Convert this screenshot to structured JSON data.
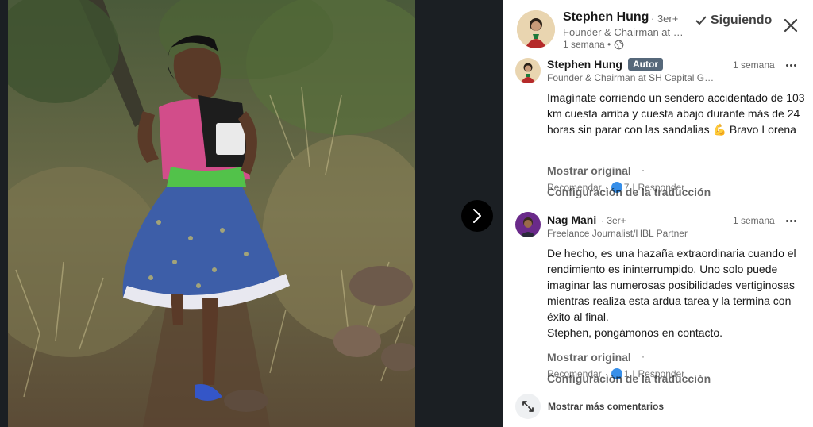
{
  "viewer": {
    "photo_alt": "Runner on trail",
    "next_icon": "chevron-right-icon"
  },
  "post": {
    "author_name": "Stephen Hung",
    "degree": "· 3er+",
    "headline": "Founder & Chairman at SH Capital G…",
    "time": "1 semana •",
    "visibility_icon": "globe-icon",
    "follow_label": "Siguiendo",
    "close_icon": "close-icon"
  },
  "comments": [
    {
      "name": "Stephen Hung",
      "badge": "Autor",
      "degree": "",
      "time": "1 semana",
      "headline": "Founder & Chairman at SH Capital G…",
      "body_lines": [
        "Imagínate corriendo un sendero accidentado de 103 km cuesta arriba y cuesta abajo durante más de 24 horas sin parar con las sandalias 💪 Bravo Lorena"
      ],
      "show_original": "Mostrar original",
      "recommend": "Recomendar",
      "reaction_count": "7",
      "reply": "Responder",
      "config": "Configuración de la traducción"
    },
    {
      "name": "Nag Mani",
      "badge": "",
      "degree": "· 3er+",
      "time": "1 semana",
      "headline": "Freelance Journalist/HBL Partner",
      "body_lines": [
        "De hecho, es una hazaña extraordinaria cuando el rendimiento es ininterrumpido. Uno solo puede imaginar las numerosas posibilidades vertiginosas mientras realiza esta ardua tarea y la termina con éxito al final.",
        "Stephen, pongámonos en contacto."
      ],
      "show_original": "Mostrar original",
      "recommend": "Recomendar",
      "reaction_count": "1",
      "reply": "Responder",
      "config": "Configuración de la traducción"
    }
  ],
  "more_comments": {
    "label": "Mostrar más comentarios",
    "icon": "expand-arrows-icon"
  },
  "colors": {
    "viewer_bg": "#1b1f23",
    "panel_bg": "#ffffff",
    "author_badge": "#56687a",
    "reaction_blue": "#378fe9"
  }
}
